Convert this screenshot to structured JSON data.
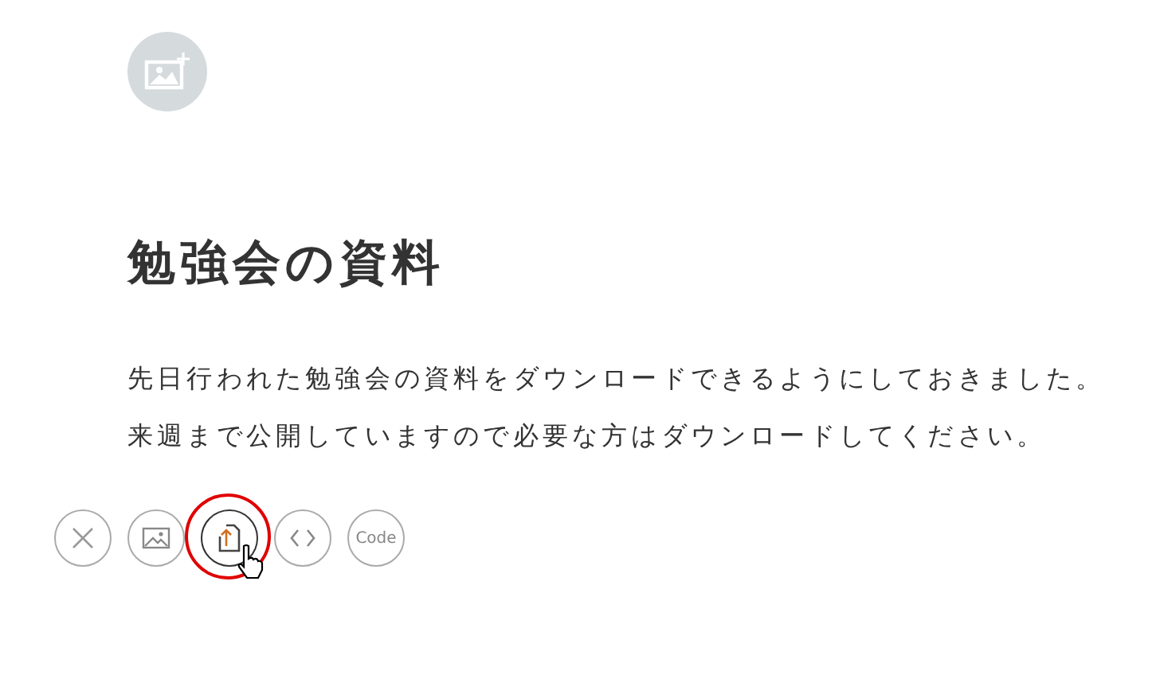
{
  "title": "勉強会の資料",
  "body": "先日行われた勉強会の資料をダウンロードできるようにしておきました。来週まで公開していますので必要な方はダウンロードしてください。",
  "tools": [
    {
      "kind": "close",
      "highlighted": false
    },
    {
      "kind": "image",
      "highlighted": false
    },
    {
      "kind": "upload",
      "highlighted": true
    },
    {
      "kind": "embed",
      "highlighted": false
    },
    {
      "kind": "code",
      "label": "Code",
      "highlighted": false
    }
  ]
}
